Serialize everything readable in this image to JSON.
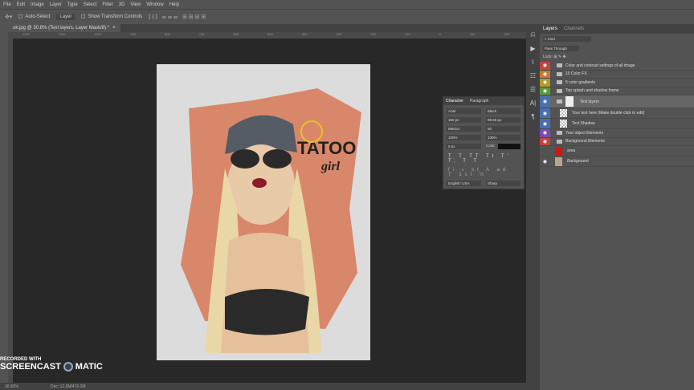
{
  "menu": [
    "File",
    "Edit",
    "Image",
    "Layer",
    "Type",
    "Select",
    "Filter",
    "3D",
    "View",
    "Window",
    "Help"
  ],
  "options": {
    "auto_select": "Auto-Select",
    "layer": "Layer",
    "transform": "Show Transform Controls"
  },
  "doc_tab": "ok.jpg @ 30.8% (Text layers, Layer Mask/8) *",
  "ruler_ticks": [
    "1200",
    "1100",
    "1000",
    "900",
    "800",
    "700",
    "600",
    "500",
    "400",
    "300",
    "200",
    "100",
    "0",
    "100",
    "200",
    "300",
    "400"
  ],
  "status": {
    "zoom": "30.83%",
    "doc": "Doc: 12.0M/470.2M"
  },
  "watermark": {
    "line1": "RECORDED WITH",
    "line2": "SCREENCAST",
    "line3": "MATIC"
  },
  "artwork": {
    "title": "TATOO",
    "subtitle": "girl"
  },
  "character": {
    "tabs": [
      "Character",
      "Paragraph"
    ],
    "font": "Arial",
    "style": "Black",
    "size": "150 px",
    "leading": "99.65 px",
    "kerning": "Metrics",
    "tracking": "50",
    "vscale": "100%",
    "hscale": "100%",
    "baseline": "0 px",
    "color_label": "Color:",
    "language": "English: USA",
    "aa": "Sharp"
  },
  "layers_panel": {
    "tabs": [
      "Layers",
      "Channels"
    ],
    "kind": "Kind",
    "blend": "Pass Through",
    "lock": "Lock:",
    "items": [
      {
        "name": "Color and contrast settings of all image",
        "color": "#c0453f",
        "type": "group"
      },
      {
        "name": "10 Color FX",
        "color": "#c87a2e",
        "type": "group"
      },
      {
        "name": "5 color gradients",
        "color": "#b39a2a",
        "type": "group"
      },
      {
        "name": "Top splash and shadow frame",
        "color": "#5a9a3c",
        "type": "group"
      },
      {
        "name": "Text layers",
        "color": "#4a6fb0",
        "type": "group-selected"
      },
      {
        "name": "Your text here (Make double click to edit)",
        "color": "#4a6fb0",
        "type": "text"
      },
      {
        "name": "Text Shadow",
        "color": "#4a6fb0",
        "type": "text"
      },
      {
        "name": "Your object Elements",
        "color": "#7a4ab0",
        "type": "group"
      },
      {
        "name": "Background Elements",
        "color": "#c0453f",
        "type": "group"
      },
      {
        "name": "area",
        "color": "",
        "type": "red"
      },
      {
        "name": "Background",
        "color": "",
        "type": "photo"
      }
    ]
  }
}
